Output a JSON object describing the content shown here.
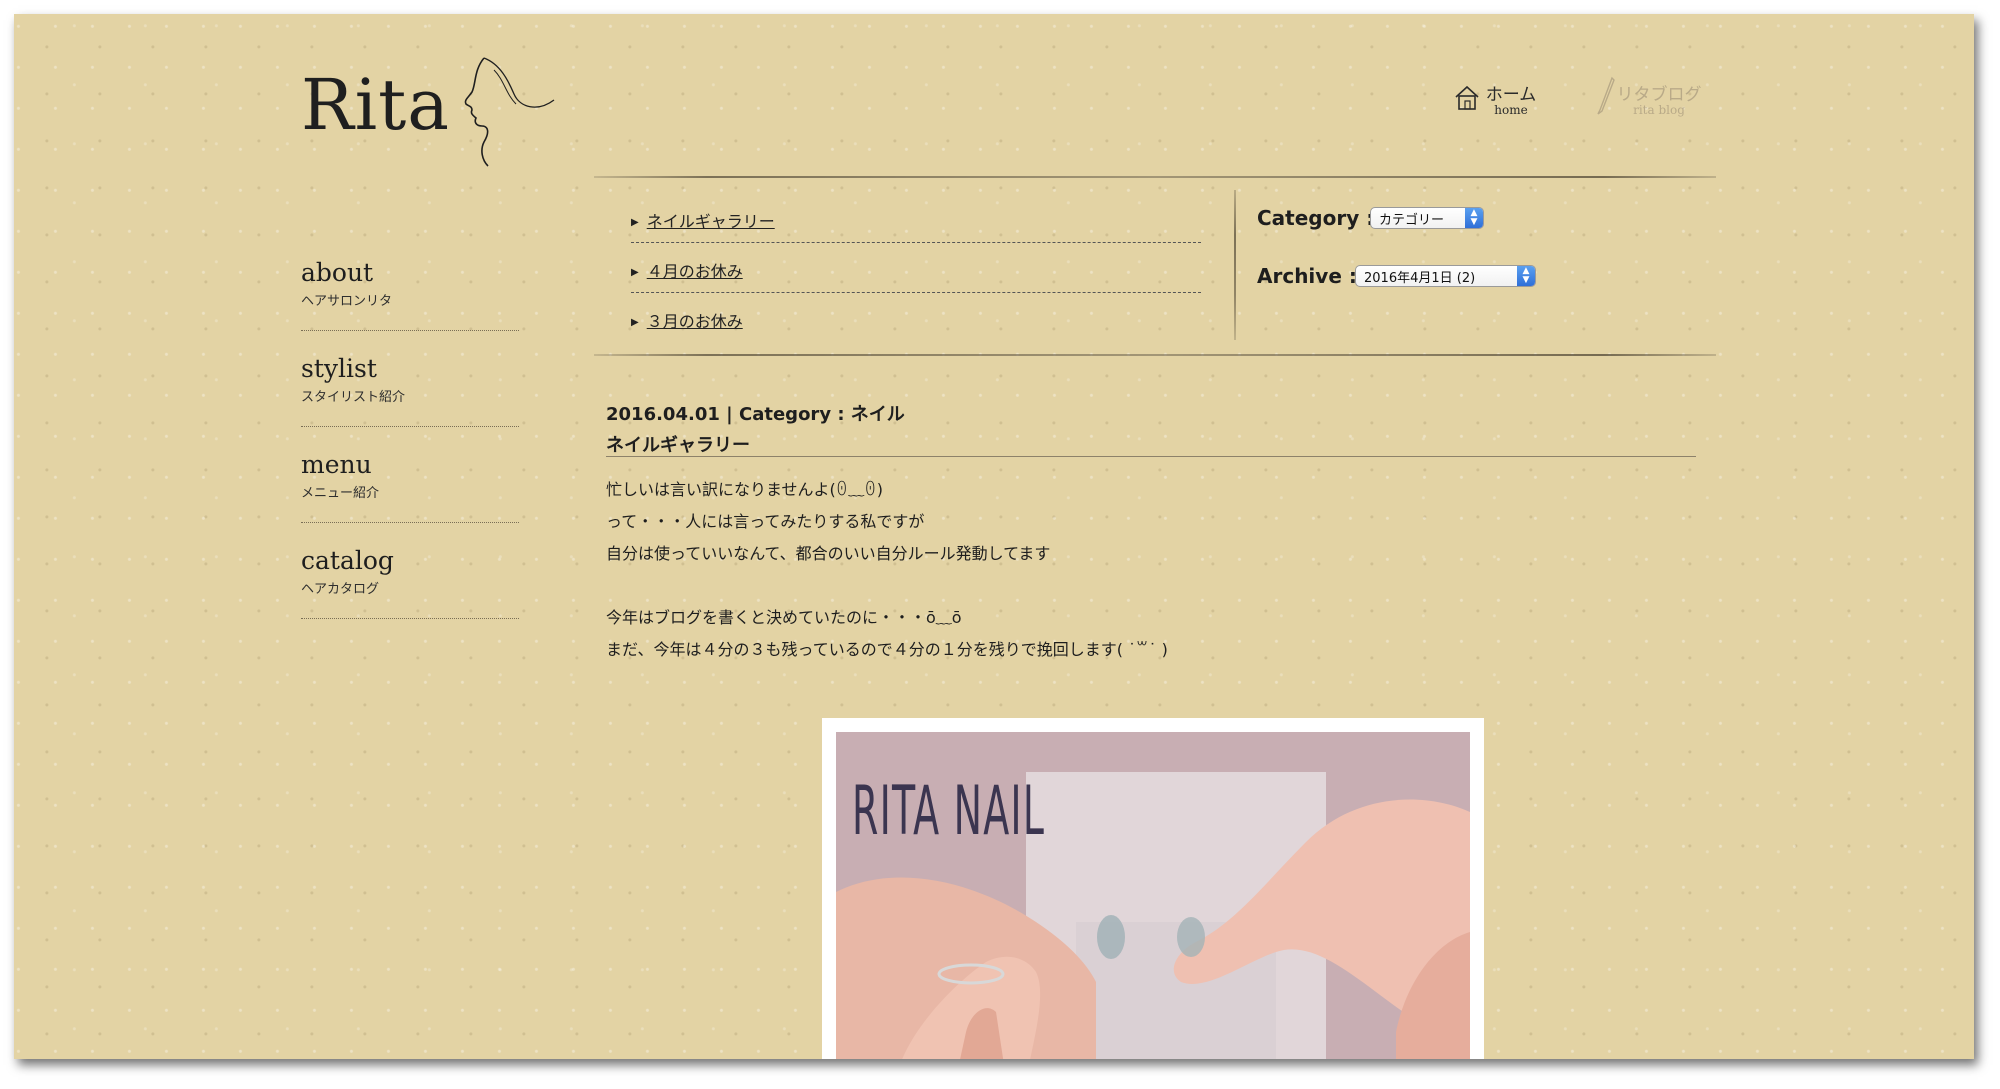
{
  "logo": {
    "text": "Rita"
  },
  "top_nav": [
    {
      "ja": "ホーム",
      "en": "home",
      "icon": "house-icon"
    },
    {
      "ja": "リタブログ",
      "en": "rita blog",
      "icon": "pen-icon"
    }
  ],
  "sidebar": {
    "items": [
      {
        "en": "about",
        "ja": "ヘアサロンリタ"
      },
      {
        "en": "stylist",
        "ja": "スタイリスト紹介"
      },
      {
        "en": "menu",
        "ja": "メニュー紹介"
      },
      {
        "en": "catalog",
        "ja": "ヘアカタログ"
      }
    ]
  },
  "recent_posts": [
    {
      "title": "ネイルギャラリー"
    },
    {
      "title": "４月のお休み"
    },
    {
      "title": "３月のお休み"
    }
  ],
  "filters": {
    "category_label": "Category :",
    "category_value": "カテゴリー",
    "archive_label": "Archive :",
    "archive_value": "2016年4月1日 (2)"
  },
  "post": {
    "date": "2016.04.01",
    "separator": "|",
    "category_label": "Category :",
    "category_value": "ネイル",
    "title": "ネイルギャラリー",
    "body_lines": [
      "忙しいは言い訳になりませんよ(ꏿ﹏ꏿ)",
      "って・・・人には言ってみたりする私ですが",
      "自分は使っていいなんて、都合のいい自分ルール発動してます",
      "",
      "今年はブログを書くと決めていたのに・・・ō﹏ō",
      "まだ、今年は４分の３も残っているので４分の１分を残りで挽回します( ˙꒳˙ )"
    ],
    "image_caption": "RITA NAIL"
  },
  "colors": {
    "background": "#e3d3a4",
    "text": "#1e1e1e",
    "select_arrow": "#2f6fd8"
  }
}
